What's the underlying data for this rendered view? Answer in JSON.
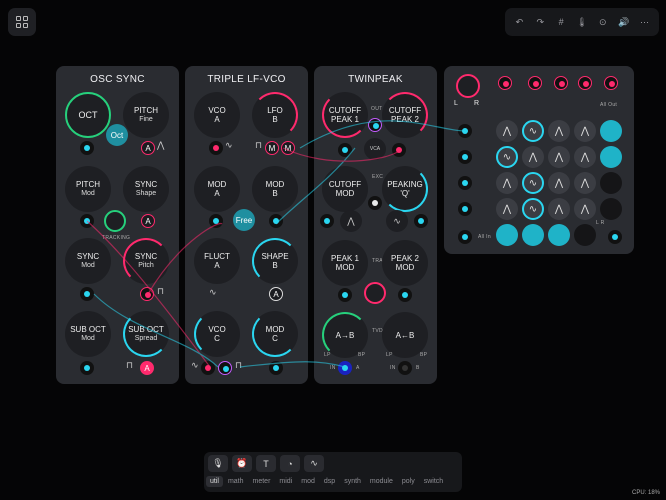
{
  "app": {
    "grid_icon": "grid-icon",
    "toolbar_icons": [
      "undo-icon",
      "redo-icon",
      "hash-icon",
      "thermometer-icon",
      "clock-icon",
      "speaker-icon",
      "ellipsis-icon"
    ],
    "toolbar_glyphs": [
      "↶",
      "↷",
      "#",
      "🌡",
      "⊙",
      "🔊",
      "⋯"
    ]
  },
  "modules": {
    "osc_sync": {
      "title": "OSC SYNC",
      "oct": "OCT",
      "pitch_fine": [
        "PITCH",
        "Fine"
      ],
      "oct_button": "Oct",
      "pitch_mod": [
        "PITCH",
        "Mod"
      ],
      "sync_shape": [
        "SYNC",
        "Shape"
      ],
      "tracking": "TRACKING",
      "sync_mod": [
        "SYNC",
        "Mod"
      ],
      "sync_pitch": [
        "SYNC",
        "Pitch"
      ],
      "sub_oct_mod": [
        "SUB OCT",
        "Mod"
      ],
      "sub_oct_spread": [
        "SUB OCT",
        "Spread"
      ],
      "badge_a": "A"
    },
    "triple_lfvco": {
      "title": "TRIPLE LF-VCO",
      "vco_a": [
        "VCO",
        "A"
      ],
      "lfo_b": [
        "LFO",
        "B"
      ],
      "mod_a": [
        "MOD",
        "A"
      ],
      "mod_b": [
        "MOD",
        "B"
      ],
      "free_button": "Free",
      "fluct_a": [
        "FLUCT",
        "A"
      ],
      "shape_b": [
        "SHAPE",
        "B"
      ],
      "vco_c": [
        "VCO",
        "C"
      ],
      "mod_c": [
        "MOD",
        "C"
      ],
      "badge_m": "M",
      "badge_a": "A"
    },
    "twinpeak": {
      "title": "TWINPEAK",
      "cutoff_peak1": [
        "CUTOFF",
        "PEAK 1"
      ],
      "cutoff_peak2": [
        "CUTOFF",
        "PEAK 2"
      ],
      "out_label": "OUT",
      "vca_label": "VCA",
      "cutoff_mod": [
        "CUTOFF",
        "MOD"
      ],
      "exc_label": "EXC",
      "peaking_q": [
        "PEAKING",
        "'Q'"
      ],
      "peak1_mod": [
        "PEAK 1",
        "MOD"
      ],
      "peak2_mod": [
        "PEAK 2",
        "MOD"
      ],
      "tracking": "TRACKING",
      "a_to_b": "A→B",
      "a_from_b": "A←B",
      "tvdc": "TVDC",
      "lp": "LP",
      "bp": "BP",
      "in": "IN",
      "a": "A",
      "b": "B"
    },
    "mixer": {
      "l": "L",
      "r": "R",
      "all_out": "All Out",
      "all_in": "All In",
      "lr": "L R"
    }
  },
  "bottom_bar": {
    "icons": [
      "microphone-icon",
      "alarm-icon",
      "text-icon",
      "gauge-icon",
      "wave-icon"
    ],
    "icon_glyphs": [
      "🎙",
      "⏰",
      "T",
      "◔",
      "∿"
    ],
    "categories": [
      "util",
      "math",
      "meter",
      "midi",
      "mod",
      "dsp",
      "synth",
      "module",
      "poly",
      "switch"
    ],
    "active_category": "util",
    "cpu": "CPU: 18%"
  }
}
